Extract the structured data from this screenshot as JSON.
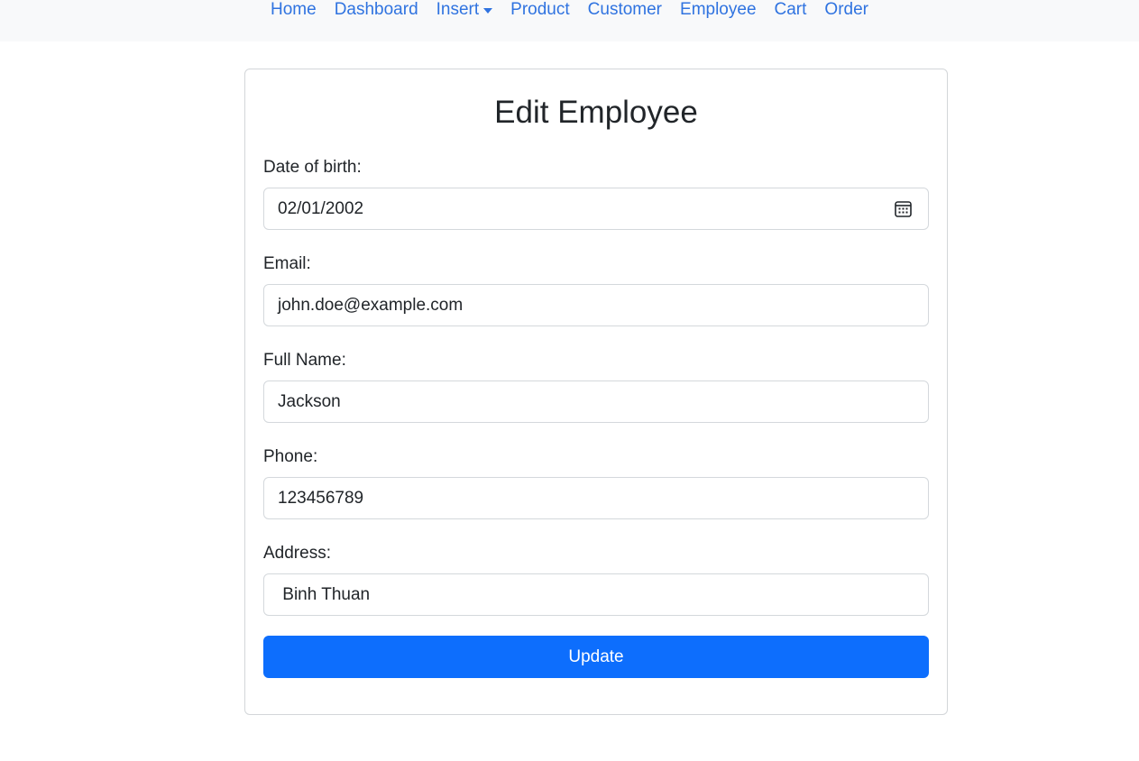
{
  "nav": {
    "items": [
      {
        "label": "Home"
      },
      {
        "label": "Dashboard"
      },
      {
        "label": "Insert"
      },
      {
        "label": "Product"
      },
      {
        "label": "Customer"
      },
      {
        "label": "Employee"
      },
      {
        "label": "Cart"
      },
      {
        "label": "Order"
      }
    ]
  },
  "form": {
    "title": "Edit Employee",
    "fields": [
      {
        "label": "Date of birth:",
        "value": "02/01/2002",
        "icon": "calendar-icon"
      },
      {
        "label": "Email:",
        "value": "john.doe@example.com"
      },
      {
        "label": "Full Name:",
        "value": "Jackson"
      },
      {
        "label": "Phone:",
        "value": "123456789"
      },
      {
        "label": "Address:",
        "value": " Binh Thuan"
      }
    ],
    "submit_label": "Update"
  },
  "colors": {
    "primary": "#0d6efd",
    "link": "#2f73e0",
    "navbar_bg": "#f8f9fa",
    "border": "#d4d8dc"
  }
}
